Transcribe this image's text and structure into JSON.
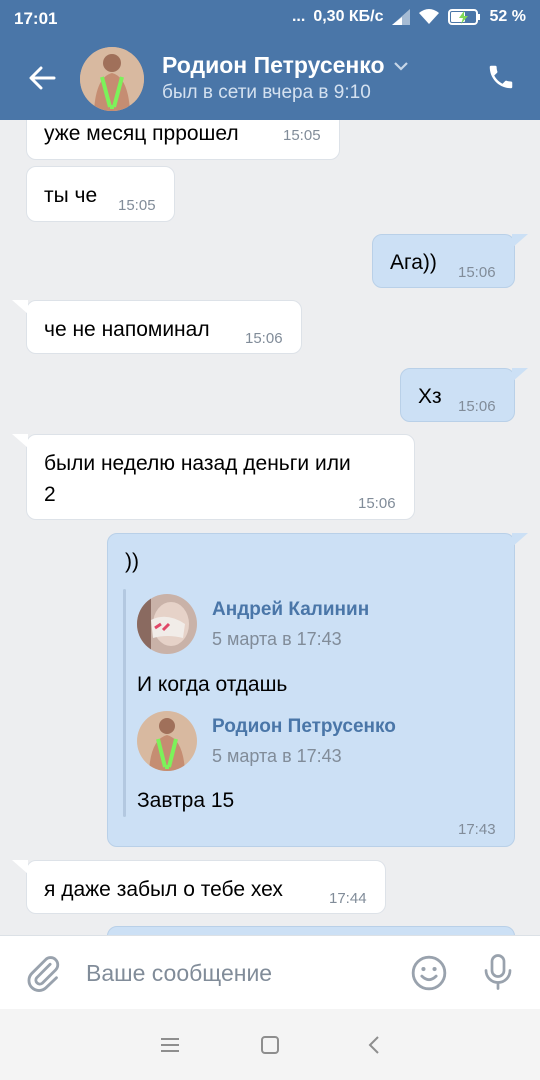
{
  "status_bar": {
    "time": "17:01",
    "dots": "...",
    "speed": "0,30 КБ/с",
    "battery": "52 %"
  },
  "header": {
    "contact_name": "Родион Петрусенко",
    "last_seen": "был в сети вчера в 9:10"
  },
  "messages": [
    {
      "dir": "in",
      "text": "уже месяц пррошел",
      "time": "15:05"
    },
    {
      "dir": "in",
      "text": "ты че",
      "time": "15:05"
    },
    {
      "dir": "out",
      "text": "Ага))",
      "time": "15:06"
    },
    {
      "dir": "in",
      "text": "че не напоминал",
      "time": "15:06"
    },
    {
      "dir": "out",
      "text": "Хз",
      "time": "15:06"
    },
    {
      "dir": "in",
      "text_line1": "были неделю назад деньги или",
      "text_line2": "2",
      "time": "15:06"
    },
    {
      "dir": "out",
      "text": "))",
      "time": "17:43",
      "forwarded": [
        {
          "author": "Андрей Калинин",
          "date": "5 марта в 17:43",
          "text": "И когда отдашь"
        },
        {
          "author": "Родион Петрусенко",
          "date": "5 марта в 17:43",
          "text": "Завтра 15"
        }
      ]
    },
    {
      "dir": "in",
      "text": "я даже забыл о тебе хех",
      "time": "17:44"
    }
  ],
  "input": {
    "placeholder": "Ваше сообщение"
  },
  "icons": {
    "back": "arrow-left-icon",
    "call": "phone-icon",
    "attach": "paperclip-icon",
    "emoji": "smile-icon",
    "mic": "microphone-icon"
  },
  "colors": {
    "header": "#4a76a8",
    "incoming": "#ffffff",
    "outgoing": "#cce0f5",
    "link": "#4a76a8",
    "background": "#edeef0"
  }
}
